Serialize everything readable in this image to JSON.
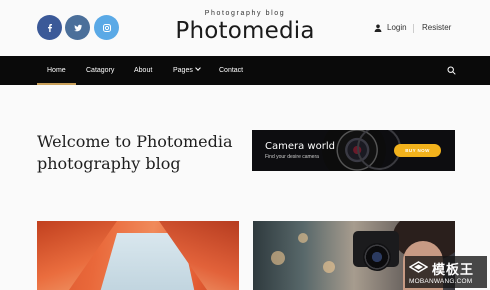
{
  "header": {
    "social": [
      {
        "name": "facebook-icon",
        "color": "#3b5998",
        "glyph": "f"
      },
      {
        "name": "twitter-icon",
        "color": "#4b6f9a",
        "glyph": "twitter-bird"
      },
      {
        "name": "instagram-icon",
        "color": "#5aa9e6",
        "glyph": "camera"
      }
    ],
    "tagline": "Photography blog",
    "brand": "Photomedia",
    "login_label": "Login",
    "register_label": "Resister"
  },
  "nav": {
    "items": [
      {
        "label": "Home",
        "active": true
      },
      {
        "label": "Catagory",
        "active": false
      },
      {
        "label": "About",
        "active": false
      },
      {
        "label": "Pages",
        "active": false,
        "has_dropdown": true
      },
      {
        "label": "Contact",
        "active": false
      }
    ],
    "accent_color": "#c9a05a",
    "search_icon": "search-icon"
  },
  "welcome": {
    "line1": "Welcome to Photomedia",
    "line2": "photography blog"
  },
  "banner": {
    "title": "Camera world",
    "subtitle": "Find your desire camera",
    "cta_label": "BUY NOW",
    "cta_color": "#f2b21c"
  },
  "watermark": {
    "cn": "模板王",
    "url": "MOBANWANG.COM"
  }
}
